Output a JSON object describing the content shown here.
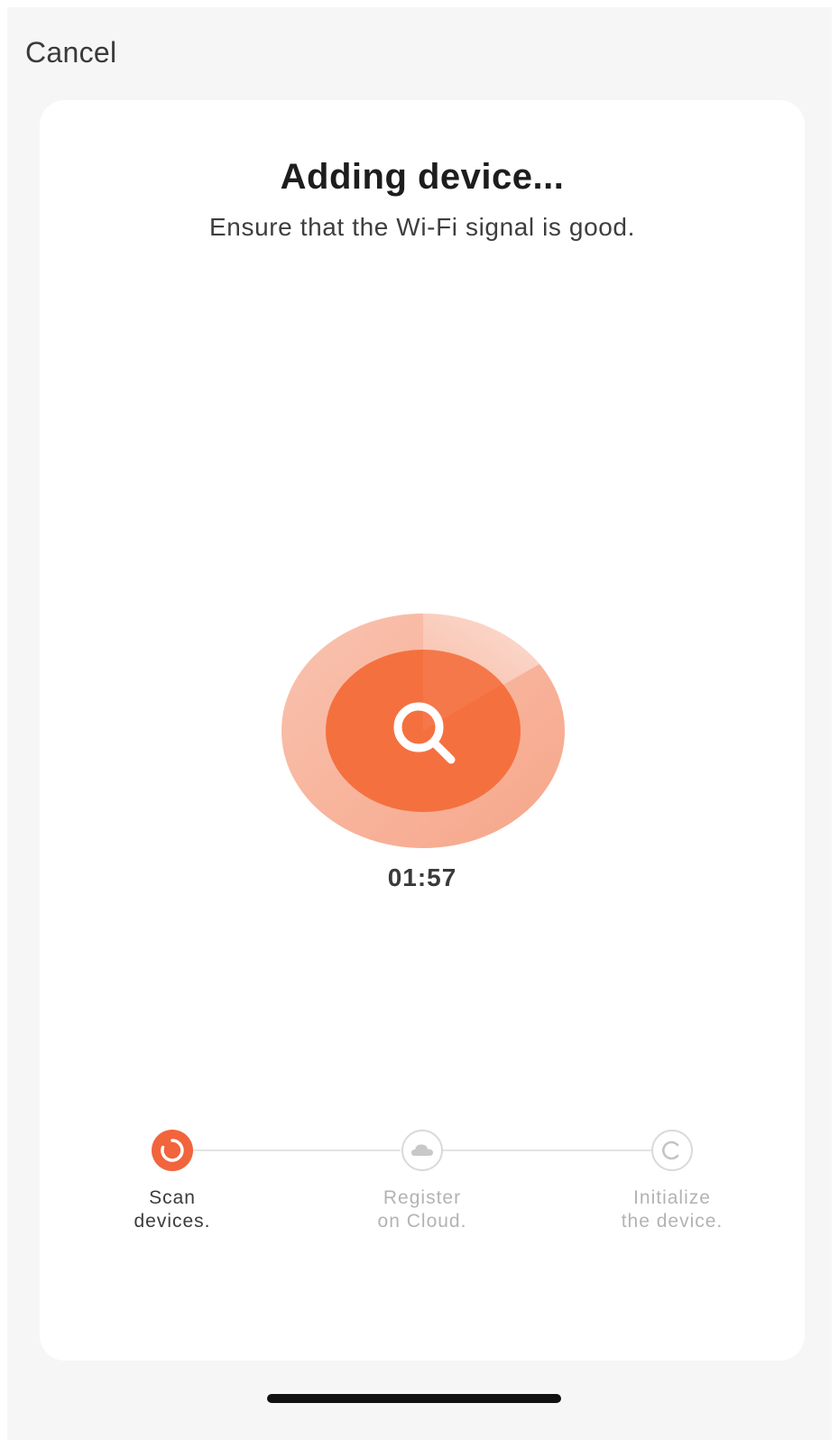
{
  "header": {
    "cancel_label": "Cancel"
  },
  "main": {
    "title": "Adding device...",
    "subtitle": "Ensure that the Wi-Fi signal is good.",
    "timer": "01:57",
    "scan_icon": "search-icon"
  },
  "steps": [
    {
      "line1": "Scan",
      "line2": "devices.",
      "state": "active",
      "icon": "loading-icon"
    },
    {
      "line1": "Register",
      "line2": "on Cloud.",
      "state": "pending",
      "icon": "cloud-icon"
    },
    {
      "line1": "Initialize",
      "line2": "the device.",
      "state": "pending",
      "icon": "initialize-icon"
    }
  ],
  "colors": {
    "accent": "#f2643c",
    "accent_inner": "#f5703f",
    "outer_ring": "#f8b39c",
    "outer_ring_light": "#fcd9cd",
    "background": "#f6f6f6",
    "card": "#ffffff",
    "inactive": "#c8c8c8"
  }
}
